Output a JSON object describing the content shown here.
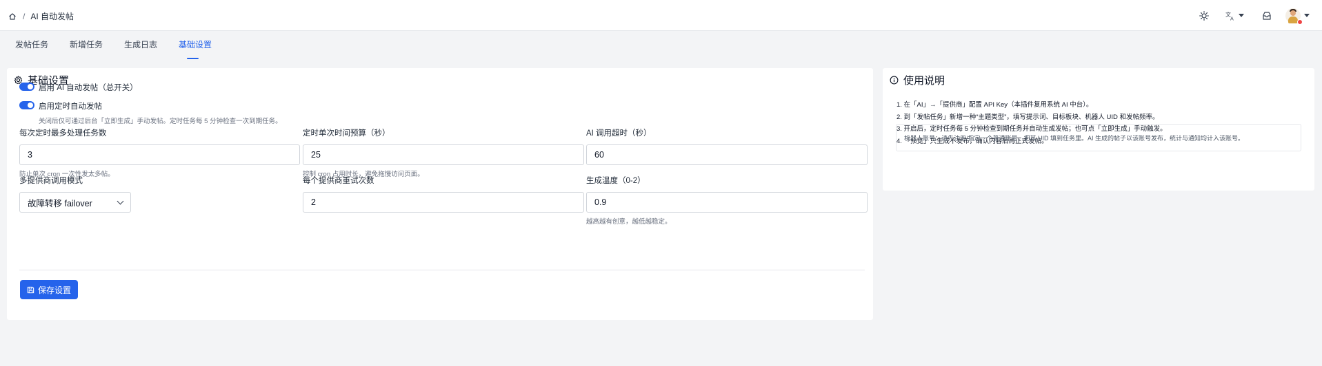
{
  "breadcrumb": {
    "current": "AI 自动发帖"
  },
  "topbar": {
    "icons": [
      "sun-icon",
      "translate-icon",
      "inbox-icon",
      "avatar"
    ]
  },
  "tabs": [
    {
      "label": "发帖任务",
      "active": false
    },
    {
      "label": "新增任务",
      "active": false
    },
    {
      "label": "生成日志",
      "active": false
    },
    {
      "label": "基础设置",
      "active": true
    }
  ],
  "settings": {
    "title": "基础设置",
    "switch_enable": {
      "label": "启用 AI 自动发帖（总开关）",
      "on": true
    },
    "switch_cron": {
      "label": "启用定时自动发帖",
      "hint": "关闭后仅可通过后台「立即生成」手动发帖。定时任务每 5 分钟检查一次到期任务。",
      "on": true
    },
    "max_tasks": {
      "label": "每次定时最多处理任务数",
      "value": "3",
      "hint": "防止单次 cron 一次性发太多帖。"
    },
    "time_budget": {
      "label": "定时单次时间预算（秒）",
      "value": "25",
      "hint": "控制 cron 占用时长，避免拖慢访问页面。"
    },
    "ai_timeout": {
      "label": "AI 调用超时（秒）",
      "value": "60"
    },
    "provider_mode": {
      "label": "多提供商调用模式",
      "value": "故障转移 failover"
    },
    "retry_count": {
      "label": "每个提供商重试次数",
      "value": "2"
    },
    "temperature": {
      "label": "生成温度（0-2）",
      "value": "0.9",
      "hint": "越高越有创意，越低越稳定。"
    },
    "save_label": "保存设置"
  },
  "help": {
    "title": "使用说明",
    "steps": [
      "1. 在「AI」→「提供商」配置 API Key（本插件复用系统 AI 中台）。",
      "2. 到「发帖任务」新增一种“主题类型”，填写提示词、目标板块、机器人 UID 和发帖频率。",
      "3. 开启后，定时任务每 5 分钟检查到期任务并自动生成发帖；也可点「立即生成」手动触发。",
      "4. 「预览」只生成不发布，确认内容后再正式发帖。"
    ],
    "note": "机器人账号：请先注册/指定一个普通账号，把其 UID 填到任务里。AI 生成的帖子以该账号发布，统计与通知均计入该账号。"
  },
  "colors": {
    "accent": "#2563eb",
    "background": "#f3f4f6"
  }
}
